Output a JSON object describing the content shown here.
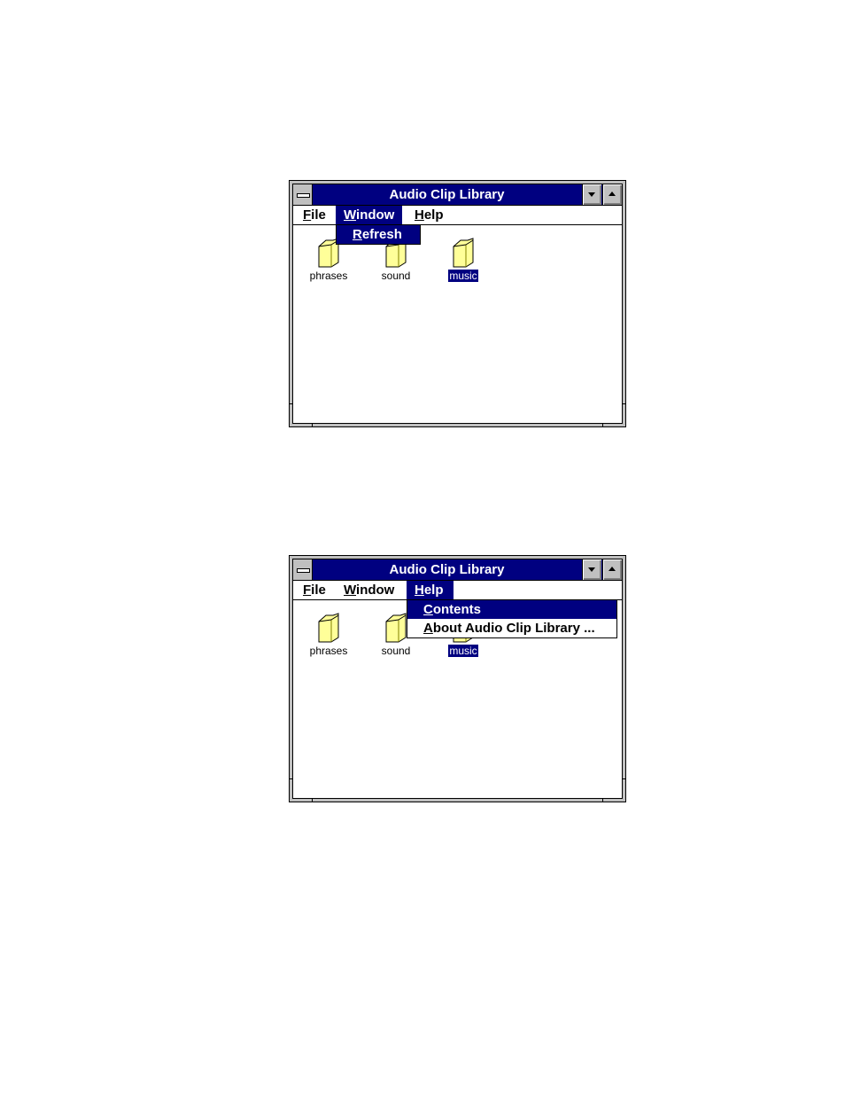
{
  "windows": [
    {
      "title": "Audio Clip Library",
      "menu": [
        {
          "label_ul": "F",
          "label_rest": "ile",
          "active": false
        },
        {
          "label_ul": "W",
          "label_rest": "indow",
          "active": true
        },
        {
          "label_ul": "H",
          "label_rest": "elp",
          "active": false
        }
      ],
      "open_menu": "Window",
      "dropdown": [
        {
          "label_ul": "R",
          "label_rest": "efresh",
          "highlighted": true
        }
      ],
      "icons": [
        {
          "label": "phrases",
          "icon": "folder-icon",
          "selected": false
        },
        {
          "label": "sound",
          "icon": "folder-icon",
          "selected": false
        },
        {
          "label": "music",
          "icon": "folder-icon",
          "selected": true
        }
      ]
    },
    {
      "title": "Audio Clip Library",
      "menu": [
        {
          "label_ul": "F",
          "label_rest": "ile",
          "active": false
        },
        {
          "label_ul": "W",
          "label_rest": "indow",
          "active": false
        },
        {
          "label_ul": "H",
          "label_rest": "elp",
          "active": true
        }
      ],
      "open_menu": "Help",
      "dropdown": [
        {
          "label_ul": "C",
          "label_rest": "ontents",
          "highlighted": true
        },
        {
          "label_ul": "A",
          "label_rest": "bout Audio Clip Library ...",
          "highlighted": false
        }
      ],
      "icons": [
        {
          "label": "phrases",
          "icon": "folder-icon",
          "selected": false
        },
        {
          "label": "sound",
          "icon": "folder-icon",
          "selected": false
        },
        {
          "label": "music",
          "icon": "folder-icon",
          "selected": true
        }
      ]
    }
  ],
  "colors": {
    "titlebar": "#000080",
    "selection": "#000080",
    "frame": "#c0c0c0",
    "folder": "#ffff99"
  }
}
